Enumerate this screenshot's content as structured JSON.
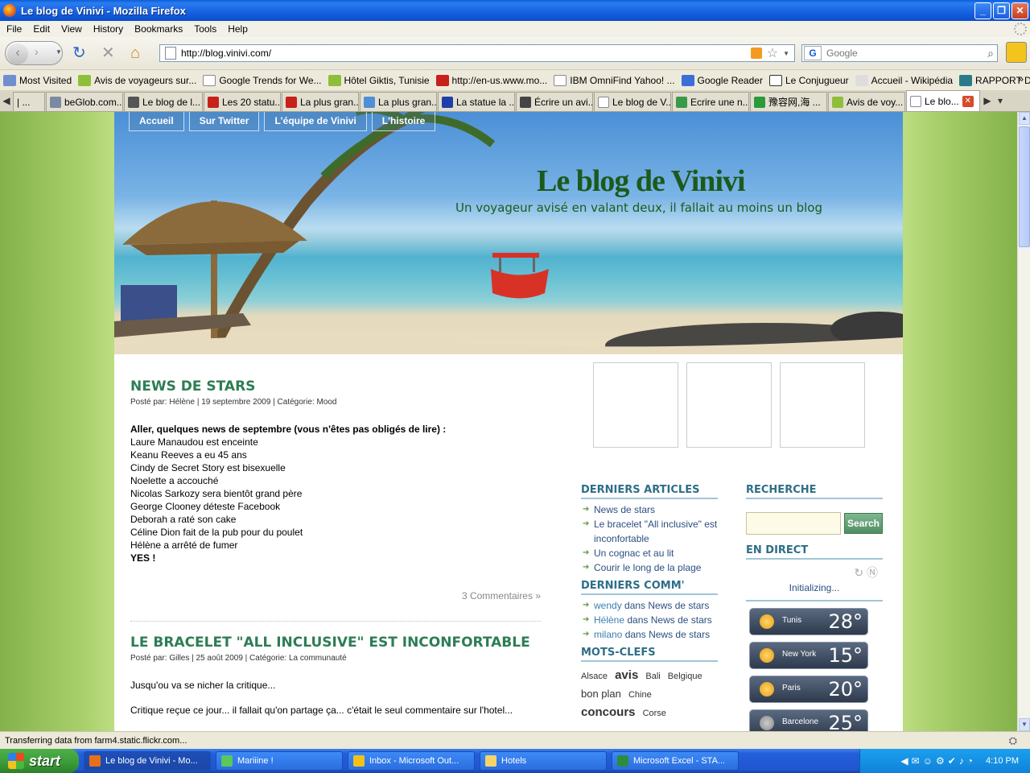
{
  "window": {
    "title": "Le blog de Vinivi - Mozilla Firefox"
  },
  "menu": [
    "File",
    "Edit",
    "View",
    "History",
    "Bookmarks",
    "Tools",
    "Help"
  ],
  "nav": {
    "url": "http://blog.vinivi.com/",
    "search_placeholder": "Google",
    "search_engine_letter": "G"
  },
  "bookmarks": [
    "Most Visited",
    "Avis de voyageurs sur...",
    "Google Trends for We...",
    "Hôtel Giktis, Tunisie",
    "http://en-us.www.mo...",
    "IBM OmniFind Yahoo! ...",
    "Google Reader",
    "Le Conjugueur",
    "Accueil - Wikipédia",
    "RAPPORT DE TRACKI..."
  ],
  "bookmarks_more": "»",
  "tabs": [
    "| ...",
    "beGlob.com...",
    "Le blog de l...",
    "Les 20 statu...",
    "La plus gran...",
    "La plus gran...",
    "La statue la ...",
    "Écrire un avi...",
    "Le blog de V...",
    "Ecrire une n...",
    "豫容网,海 ...",
    "Avis de voy...",
    "Le blo..."
  ],
  "site": {
    "nav": [
      "Accueil",
      "Sur Twitter",
      "L'équipe de Vinivi",
      "L'histoire"
    ],
    "title": "Le blog de Vinivi",
    "subtitle": "Un voyageur avisé en valant deux, il fallait au moins un blog"
  },
  "post1": {
    "title": "NEWS DE STARS",
    "meta": "Posté par: Hélène | 19 septembre 2009 | Catégorie: Mood",
    "lead": "Aller, quelques news de septembre (vous n'êtes pas obligés de lire) :",
    "lines": [
      "Laure Manaudou est enceinte",
      "Keanu Reeves a eu 45 ans",
      "Cindy de Secret Story est bisexuelle",
      "Noelette a accouché",
      "Nicolas Sarkozy sera bientôt grand père",
      "George Clooney déteste Facebook",
      "Deborah a raté son cake",
      "Céline Dion fait de la pub pour du poulet",
      "Hélène a arrêté de fumer"
    ],
    "end": "YES !",
    "comments": "3 Commentaires »"
  },
  "post2": {
    "title": "LE BRACELET \"ALL INCLUSIVE\" EST INCONFORTABLE",
    "meta": "Posté par: Gilles | 25 août 2009 | Catégorie: La communauté",
    "p1": "Jusqu'ou va se nicher la critique...",
    "p2": "Critique reçue ce jour... il fallait qu'on partage ça... c'était le seul commentaire sur l'hotel..."
  },
  "sidebar": {
    "articles_title": "DERNIERS ARTICLES",
    "articles": [
      "News de stars",
      "Le bracelet \"All inclusive\" est inconfortable",
      "Un cognac et au lit",
      "Courir le long de la plage"
    ],
    "comments_title": "DERNIERS COMM'",
    "comments": [
      {
        "author": "wendy",
        "sep": " dans ",
        "post": "News de stars"
      },
      {
        "author": "Hélène",
        "sep": " dans ",
        "post": "News de stars"
      },
      {
        "author": "milano",
        "sep": " dans ",
        "post": "News de stars"
      }
    ],
    "tags_title": "MOTS-CLEFS",
    "tags": [
      "Alsace",
      "avis",
      "Bali",
      "Belgique",
      "bon plan",
      "Chine",
      "concours",
      "Corse"
    ],
    "search_title": "RECHERCHE",
    "search_button": "Search",
    "direct_title": "EN DIRECT",
    "direct_status": "Initializing...",
    "weather": [
      {
        "city": "Tunis",
        "temp": "28°"
      },
      {
        "city": "New York",
        "temp": "15°"
      },
      {
        "city": "Paris",
        "temp": "20°"
      },
      {
        "city": "Barcelone",
        "temp": "25°"
      }
    ]
  },
  "status": "Transferring data from farm4.static.flickr.com...",
  "taskbar": {
    "start": "start",
    "items": [
      "Le blog de Vinivi - Mo...",
      "Mariiine !",
      "Inbox - Microsoft Out...",
      "Hotels",
      "Microsoft Excel - STA..."
    ],
    "clock": "4:10 PM"
  }
}
